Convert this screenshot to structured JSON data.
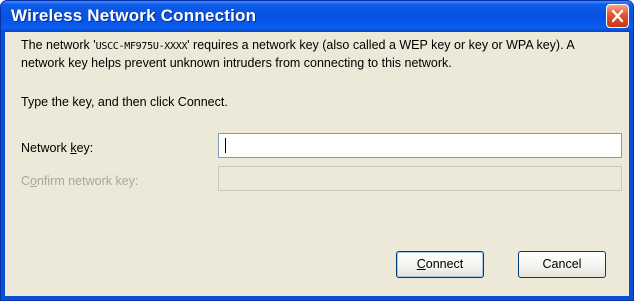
{
  "window": {
    "title": "Wireless Network Connection"
  },
  "message": {
    "prefix": "The network '",
    "network_name": "USCC-MF975U-XXXX",
    "suffix": "' requires a network key (also called a WEP key or key or WPA key). A network key helps prevent unknown intruders from connecting to this network."
  },
  "instruction": "Type the key, and then click Connect.",
  "fields": {
    "network_key": {
      "label_before": "Network ",
      "label_access": "k",
      "label_after": "ey:",
      "value": ""
    },
    "confirm_key": {
      "label_before": "C",
      "label_access": "o",
      "label_after": "nfirm network key:",
      "value": "",
      "enabled": false
    }
  },
  "buttons": {
    "connect": {
      "access": "C",
      "rest": "onnect"
    },
    "cancel": "Cancel"
  },
  "icons": {
    "close": "close-icon"
  },
  "colors": {
    "titlebar": "#0551e4",
    "close_button": "#e2552f",
    "dialog_body": "#ece9d8",
    "disabled_text": "#aca899"
  }
}
